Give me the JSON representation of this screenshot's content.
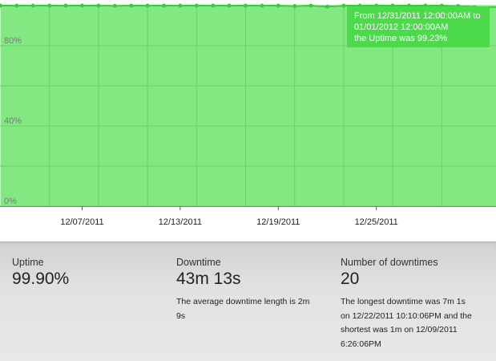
{
  "chart_data": {
    "type": "area",
    "ylim": [
      0,
      100
    ],
    "y_ticks": [
      "0%",
      "40%",
      "80%"
    ],
    "x_ticks": [
      "12/07/2011",
      "12/13/2011",
      "12/19/2011",
      "12/25/2011"
    ],
    "x": [
      "12/02/2011",
      "12/03/2011",
      "12/04/2011",
      "12/05/2011",
      "12/06/2011",
      "12/07/2011",
      "12/08/2011",
      "12/09/2011",
      "12/10/2011",
      "12/11/2011",
      "12/12/2011",
      "12/13/2011",
      "12/14/2011",
      "12/15/2011",
      "12/16/2011",
      "12/17/2011",
      "12/18/2011",
      "12/19/2011",
      "12/20/2011",
      "12/21/2011",
      "12/22/2011",
      "12/23/2011",
      "12/24/2011",
      "12/25/2011",
      "12/26/2011",
      "12/27/2011",
      "12/28/2011",
      "12/29/2011",
      "12/30/2011",
      "12/31/2011"
    ],
    "values": [
      100,
      100,
      100,
      100,
      100,
      100,
      100,
      99.9,
      100,
      100,
      100,
      100,
      100,
      100,
      100,
      100,
      100,
      100,
      99.8,
      100,
      99.5,
      100,
      100,
      100,
      100,
      100,
      100,
      100,
      99.8,
      99.23
    ],
    "grid": true,
    "colors": {
      "fill": "#82e882",
      "line": "#44c444",
      "tooltip": "#4cd94c"
    },
    "tooltip": {
      "lines": [
        "From 12/31/2011 12:00:00AM to",
        "01/01/2012 12:00:00AM",
        "the Uptime was 99.23%"
      ]
    }
  },
  "stats": {
    "uptime": {
      "label": "Uptime",
      "value": "99.90%"
    },
    "downtime": {
      "label": "Downtime",
      "value": "43m 13s",
      "note_lines": [
        "The average downtime length is 2m",
        "9s"
      ]
    },
    "downtimes": {
      "label": "Number of downtimes",
      "value": "20",
      "note_lines": [
        "The longest downtime was 7m 1s",
        "on 12/22/2011 10:10:06PM and the",
        "shortest was 1m on 12/09/2011",
        "6:26:06PM"
      ]
    }
  }
}
